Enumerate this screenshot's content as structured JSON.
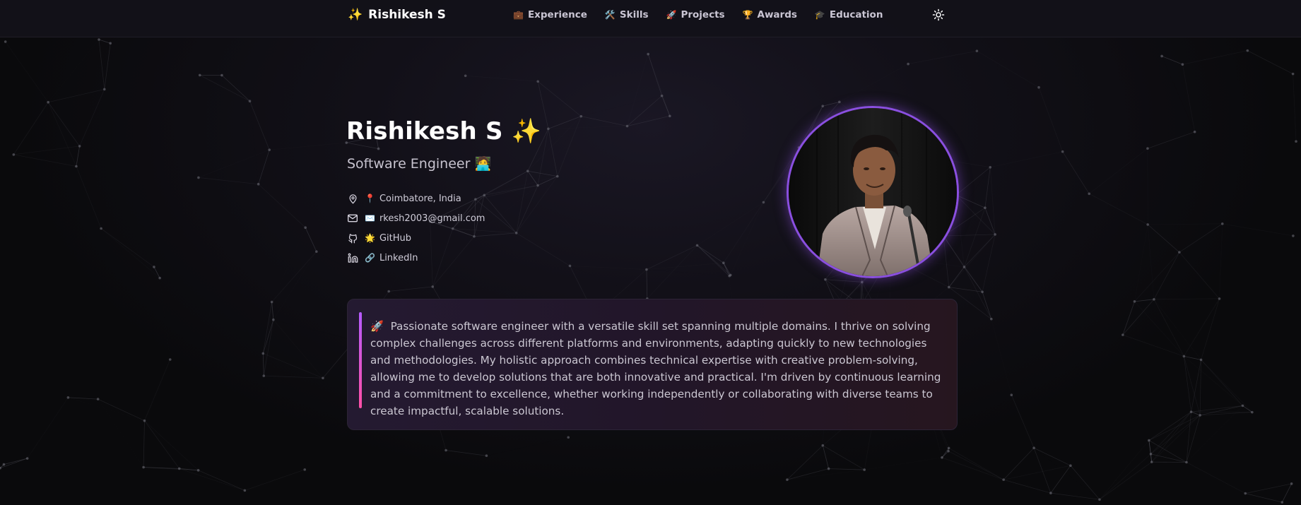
{
  "header": {
    "brand_icon": "✨",
    "brand_name": "Rishikesh S",
    "nav": [
      {
        "icon": "💼",
        "icon_name": "briefcase-icon",
        "label": "Experience"
      },
      {
        "icon": "🛠️",
        "icon_name": "tools-icon",
        "label": "Skills"
      },
      {
        "icon": "🚀",
        "icon_name": "rocket-icon",
        "label": "Projects"
      },
      {
        "icon": "🏆",
        "icon_name": "trophy-icon",
        "label": "Awards"
      },
      {
        "icon": "🎓",
        "icon_name": "graduation-cap-icon",
        "label": "Education"
      }
    ],
    "theme_toggle_icon": "sun-icon"
  },
  "hero": {
    "name": "Rishikesh S",
    "name_emoji": "✨",
    "role": "Software Engineer",
    "role_emoji": "🧑‍💻",
    "contacts": [
      {
        "line_icon": "location-pin-icon",
        "emoji": "📍",
        "label": "Coimbatore, India"
      },
      {
        "line_icon": "mail-icon",
        "emoji": "✉️",
        "label": "rkesh2003@gmail.com"
      },
      {
        "line_icon": "github-icon",
        "emoji": "🌟",
        "label": "GitHub"
      },
      {
        "line_icon": "linkedin-icon",
        "emoji": "🔗",
        "label": "LinkedIn"
      }
    ]
  },
  "about": {
    "emoji": "🚀",
    "text": "Passionate software engineer with a versatile skill set spanning multiple domains. I thrive on solving complex challenges across different platforms and environments, adapting quickly to new technologies and methodologies. My holistic approach combines technical expertise with creative problem-solving, allowing me to develop solutions that are both innovative and practical. I'm driven by continuous learning and a commitment to excellence, whether working independently or collaborating with diverse teams to create impactful, scalable solutions."
  },
  "colors": {
    "background": "#0c0b0f",
    "accent_purple": "#8a4fe0",
    "accent_pink": "#ff4fa6",
    "brand_spark": "#f6c84a"
  }
}
